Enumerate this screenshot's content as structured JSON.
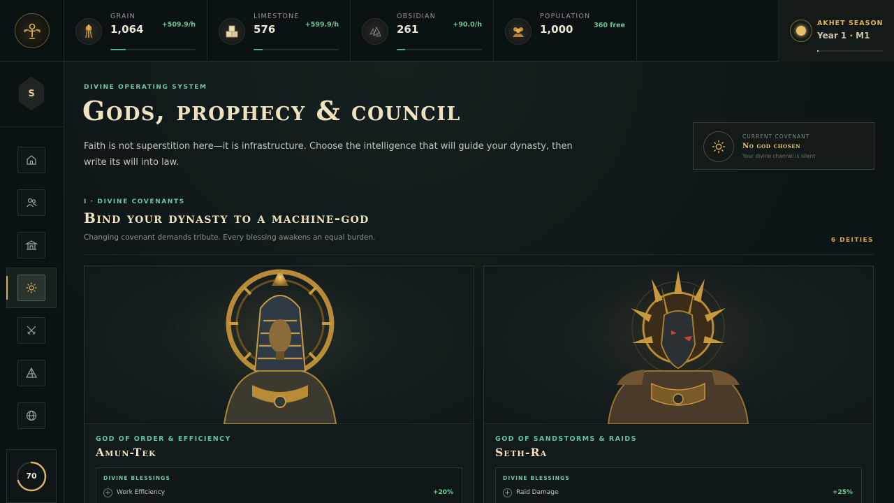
{
  "colors": {
    "accent_gold": "#e0b45c",
    "accent_teal": "#6cc7a3",
    "positive_green": "#6fd09e",
    "background": "#0d1416"
  },
  "topbar": {
    "emblem_icon": "winged-ankh-emblem-icon",
    "resources": [
      {
        "label": "GRAIN",
        "value": "1,064",
        "rate": "+509.9/h",
        "icon": "grain-sheaves-icon",
        "progress": 0.18
      },
      {
        "label": "LIMESTONE",
        "value": "576",
        "rate": "+599.9/h",
        "icon": "limestone-blocks-icon",
        "progress": 0.11
      },
      {
        "label": "OBSIDIAN",
        "value": "261",
        "rate": "+90.0/h",
        "icon": "obsidian-shards-icon",
        "progress": 0.1
      },
      {
        "label": "POPULATION",
        "value": "1,000",
        "rate": "360 free",
        "icon": "population-icon",
        "progress": null
      }
    ],
    "season": {
      "title": "AKHET SEASON",
      "subtitle": "Year 1 · M1",
      "progress": 0.02
    }
  },
  "sidebar": {
    "player_initial": "S",
    "nav": [
      {
        "name": "home",
        "icon": "home-icon"
      },
      {
        "name": "people",
        "icon": "people-icon"
      },
      {
        "name": "buildings",
        "icon": "temple-icon"
      },
      {
        "name": "gods",
        "icon": "sun-icon",
        "active": true
      },
      {
        "name": "military",
        "icon": "crossed-swords-icon"
      },
      {
        "name": "pyramid",
        "icon": "pyramid-icon"
      },
      {
        "name": "world",
        "icon": "globe-icon"
      }
    ],
    "progress_value": "70",
    "progress_fraction": 0.7
  },
  "header": {
    "eyebrow": "DIVINE OPERATING SYSTEM",
    "title": "Gods, prophecy & council",
    "intro": "Faith is not superstition here—it is infrastructure. Choose the intelligence that will guide your dynasty, then write its will into law."
  },
  "covenant": {
    "label": "CURRENT COVENANT",
    "value": "No god chosen",
    "subtitle": "Your divine channel is silent",
    "icon": "sun-icon"
  },
  "section": {
    "eyebrow": "I · DIVINE COVENANTS",
    "title": "Bind your dynasty to a machine-god",
    "description": "Changing covenant demands tribute. Every blessing awakens an equal burden.",
    "count": "6 DEITIES"
  },
  "deities": [
    {
      "epithet": "GOD OF ORDER & EFFICIENCY",
      "name": "Amun-Tek",
      "portrait": "pharaoh-sun-disc-portrait",
      "blessings_header": "DIVINE BLESSINGS",
      "blessing": {
        "name": "Work Efficiency",
        "value": "+20%"
      }
    },
    {
      "epithet": "GOD OF SANDSTORMS & RAIDS",
      "name": "Seth-Ra",
      "portrait": "jackal-spiked-crown-portrait",
      "blessings_header": "DIVINE BLESSINGS",
      "blessing": {
        "name": "Raid Damage",
        "value": "+25%"
      }
    }
  ]
}
